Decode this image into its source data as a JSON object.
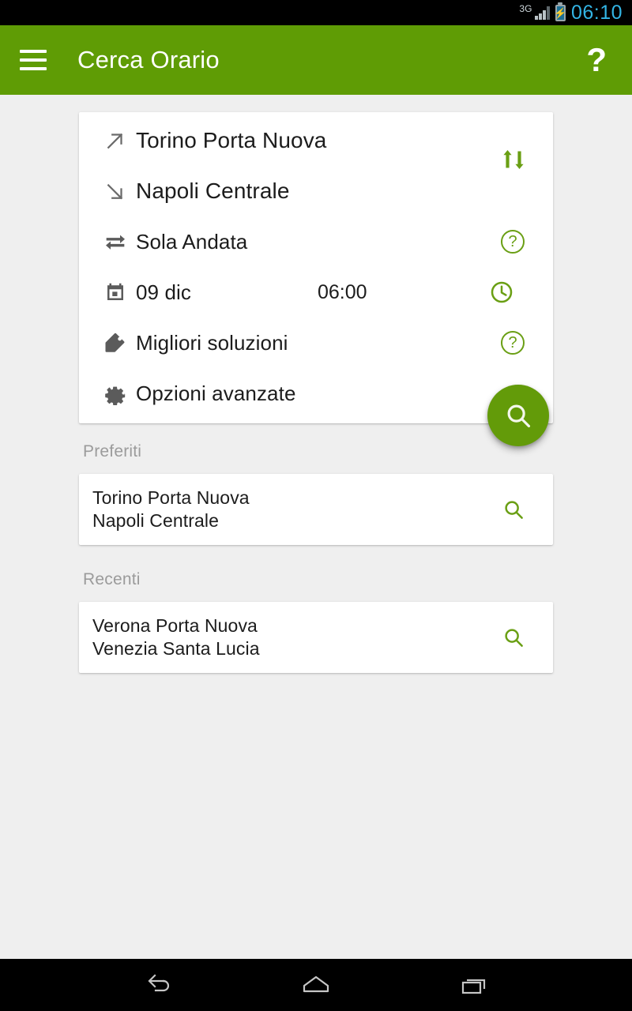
{
  "status_bar": {
    "network_type": "3G",
    "time": "06:10",
    "battery_icon": "battery-charging-icon",
    "signal_icon": "signal-bars-icon"
  },
  "app_bar": {
    "menu_icon": "hamburger-menu-icon",
    "title": "Cerca Orario",
    "help_label": "?"
  },
  "search_card": {
    "departure": {
      "icon": "arrow-up-right-icon",
      "value": "Torino Porta Nuova"
    },
    "arrival": {
      "icon": "arrow-down-right-icon",
      "value": "Napoli Centrale"
    },
    "swap_icon": "swap-vertical-arrows-icon",
    "trip_type": {
      "icon": "swap-horizontal-arrows-icon",
      "value": "Sola Andata",
      "help_label": "?"
    },
    "datetime": {
      "icon": "calendar-icon",
      "date": "09 dic",
      "time": "06:00",
      "clock_icon": "clock-icon"
    },
    "solutions": {
      "icon": "tag-icon",
      "value": "Migliori soluzioni",
      "help_label": "?"
    },
    "advanced": {
      "icon": "gear-icon",
      "value": "Opzioni avanzate"
    }
  },
  "fab": {
    "icon": "search-icon"
  },
  "favourites": {
    "title": "Preferiti",
    "items": [
      {
        "origin": "Torino Porta Nuova",
        "destination": "Napoli Centrale",
        "action_icon": "search-icon"
      }
    ]
  },
  "recents": {
    "title": "Recenti",
    "items": [
      {
        "origin": "Verona Porta Nuova",
        "destination": "Venezia Santa Lucia",
        "action_icon": "search-icon"
      }
    ]
  },
  "nav_bar": {
    "back_icon": "back-arrow-icon",
    "home_icon": "home-icon",
    "recents_icon": "recent-apps-icon"
  },
  "colors": {
    "brand_green": "#5f9c05",
    "fab_green": "#639b09",
    "accent_green": "#6a9f14",
    "background": "#efefef",
    "status_clock": "#33b5e5"
  }
}
